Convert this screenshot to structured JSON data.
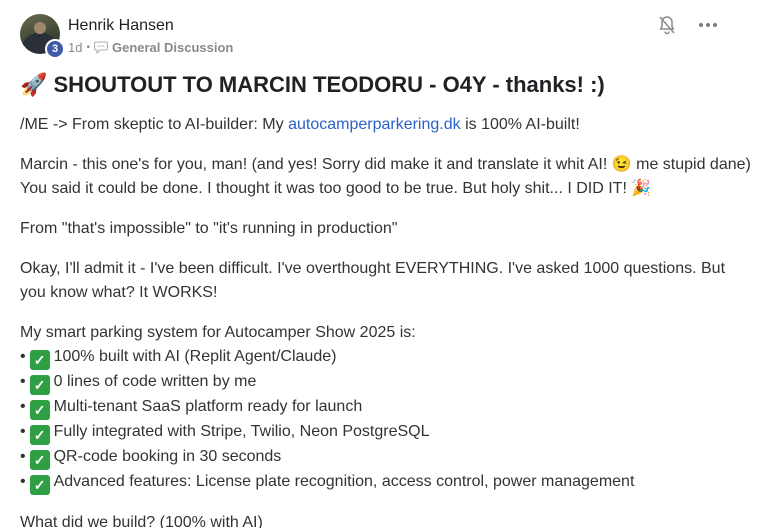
{
  "post": {
    "author": "Henrik Hansen",
    "level": "3",
    "time": "1d",
    "separator": "•",
    "category": "General Discussion",
    "title": "🚀 SHOUTOUT TO MARCIN TEODORU - O4Y - thanks! :)",
    "p1_before": "/ME -> From skeptic to AI-builder: My ",
    "p1_link": "autocamperparkering.dk",
    "p1_after": " is 100% AI-built!",
    "p2_line1": "Marcin - this one's for you, man! (and yes! Sorry did make it and translate it whit AI! 😉 me stupid dane)",
    "p2_line2": "You said it could be done. I thought it was too good to be true. But holy shit... I DID IT! 🎉",
    "p3": "From \"that's impossible\" to \"it's running in production\"",
    "p4": "Okay, I'll admit it - I've been difficult. I've overthought EVERYTHING. I've asked 1000 questions. But you know what? It WORKS!",
    "list_intro": "My smart parking system for Autocamper Show 2025 is:",
    "list_bullet": "•",
    "check_glyph": "✓",
    "list": [
      "100% built with AI (Replit Agent/Claude)",
      "0 lines of code written by me",
      "Multi-tenant SaaS platform ready for launch",
      "Fully integrated with Stripe, Twilio, Neon PostgreSQL",
      "QR-code booking in 30 seconds",
      "Advanced features: License plate recognition, access control, power management"
    ],
    "closing": "What did we build? (100% with AI)"
  },
  "icons": {
    "bell": "bell-off-icon",
    "more": "more-horizontal-icon",
    "chat": "chat-bubble-icon",
    "check": "check-mark-icon"
  },
  "colors": {
    "link": "#2a62c9",
    "badge": "#3e5aa8",
    "check": "#2ea043"
  }
}
